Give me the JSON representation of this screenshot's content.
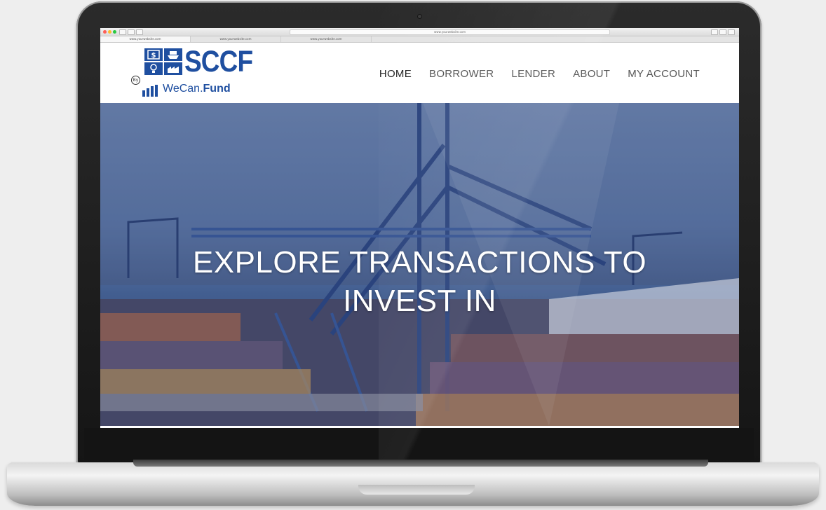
{
  "browser": {
    "address": "www.yourwebsite.com",
    "tabs": [
      "www.yourwebsite.com",
      "www.yourwebsite.com",
      "www.yourwebsite.com"
    ]
  },
  "site": {
    "logo": {
      "brand": "SCCF",
      "by": "By",
      "sub_left": "WeCan.",
      "sub_right": "Fund",
      "grid_icons": [
        "dollar-icon",
        "ship-icon",
        "lightbulb-icon",
        "factory-icon"
      ]
    },
    "nav": [
      "HOME",
      "BORROWER",
      "LENDER",
      "ABOUT",
      "MY ACCOUNT"
    ],
    "hero": {
      "line1": "EXPLORE TRANSACTIONS TO",
      "line2": "INVEST IN"
    }
  },
  "colors": {
    "brand_blue": "#1f4fa0",
    "hero_tint": "#5e77a5"
  }
}
